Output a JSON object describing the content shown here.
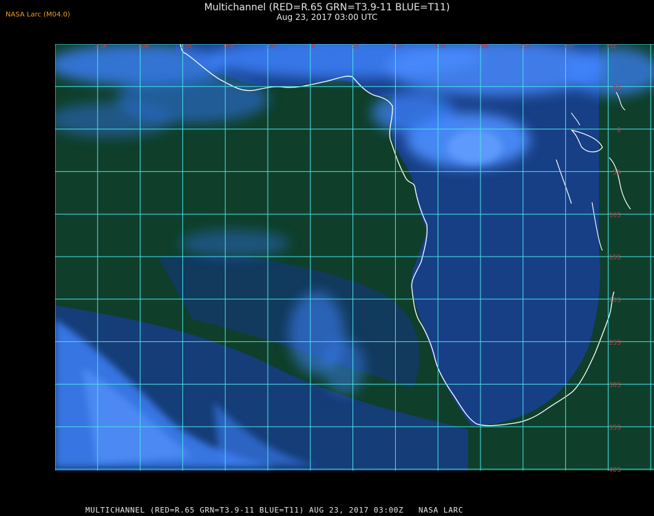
{
  "header": {
    "badge": "NASA Larc (M04.0)",
    "title": "Multichannel (RED=R.65 GRN=T3.9-11 BLUE=T11)",
    "subtitle": "Aug 23, 2017 03:00 UTC"
  },
  "footer": {
    "caption": "MULTICHANNEL (RED=R.65 GRN=T3.9-11 BLUE=T11) AUG 23, 2017 03:00Z   NASA LARC"
  },
  "map": {
    "longitude_labels": [
      "25W",
      "20W",
      "15W",
      "10W",
      "5W",
      "0",
      "5E",
      "10E",
      "15E",
      "20E",
      "25E",
      "30E",
      "35E"
    ],
    "latitude_labels": [
      "5N",
      "0",
      "5S",
      "10S",
      "15S",
      "20S",
      "25S",
      "30S",
      "35S",
      "40S"
    ],
    "colors": {
      "grid": "#49e0e6",
      "coast": "#ffffff",
      "ocean": "#0e3e2b",
      "land": "#163c84",
      "cloud": "#3f82ff",
      "label": "#c23a3a"
    }
  }
}
